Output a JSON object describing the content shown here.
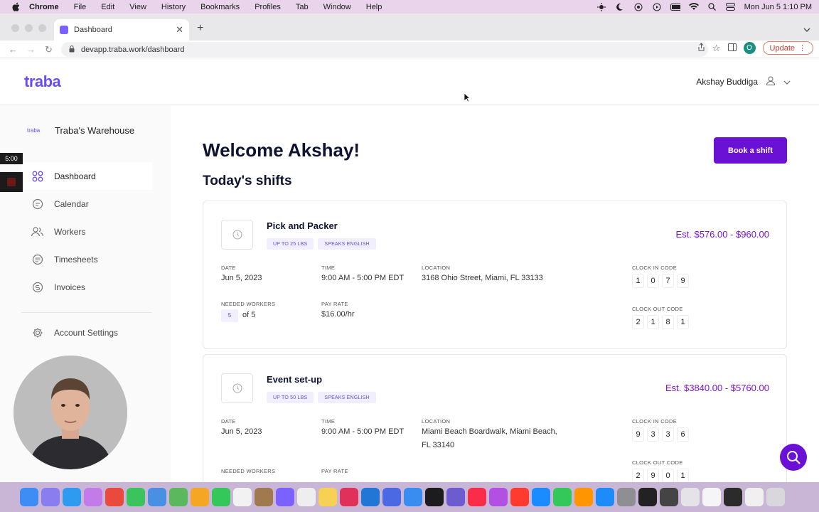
{
  "menubar": {
    "app": "Chrome",
    "items": [
      "File",
      "Edit",
      "View",
      "History",
      "Bookmarks",
      "Profiles",
      "Tab",
      "Window",
      "Help"
    ],
    "datetime": "Mon Jun 5  1:10 PM"
  },
  "browser": {
    "tab_title": "Dashboard",
    "url": "devapp.traba.work/dashboard",
    "profile_initial": "O",
    "update_label": "Update"
  },
  "header": {
    "logo": "traba",
    "user_name": "Akshay Buddiga"
  },
  "sidebar": {
    "org_logo": "traba",
    "org_name": "Traba's Warehouse",
    "items": [
      {
        "label": "Dashboard",
        "icon": "grid-icon"
      },
      {
        "label": "Calendar",
        "icon": "calendar-icon"
      },
      {
        "label": "Workers",
        "icon": "people-icon"
      },
      {
        "label": "Timesheets",
        "icon": "timesheet-icon"
      },
      {
        "label": "Invoices",
        "icon": "invoice-icon"
      }
    ],
    "settings_label": "Account Settings"
  },
  "recording": {
    "timer": "5:00"
  },
  "main": {
    "welcome": "Welcome Akshay!",
    "todays_shifts": "Today's shifts",
    "book_shift": "Book a shift",
    "labels": {
      "date": "DATE",
      "time": "TIME",
      "location": "LOCATION",
      "clock_in": "CLOCK IN CODE",
      "clock_out": "CLOCK OUT CODE",
      "needed_workers": "NEEDED WORKERS",
      "pay_rate": "PAY RATE"
    },
    "shifts": [
      {
        "title": "Pick and Packer",
        "tags": [
          "UP TO 25 LBS",
          "SPEAKS ENGLISH"
        ],
        "estimate": "Est. $576.00 - $960.00",
        "date": "Jun 5, 2023",
        "time": "9:00 AM - 5:00 PM EDT",
        "location": "3168 Ohio Street, Miami, FL 33133",
        "clock_in": [
          "1",
          "0",
          "7",
          "9"
        ],
        "clock_out": [
          "2",
          "1",
          "8",
          "1"
        ],
        "workers_filled": "5",
        "workers_total": "of 5",
        "pay_rate": "$16.00/hr"
      },
      {
        "title": "Event set-up",
        "tags": [
          "UP TO 50 LBS",
          "SPEAKS ENGLISH"
        ],
        "estimate": "Est. $3840.00 - $5760.00",
        "date": "Jun 5, 2023",
        "time": "9:00 AM - 5:00 PM EDT",
        "location_line1": "Miami Beach Boardwalk, Miami Beach,",
        "location_line2": "FL 33140",
        "clock_in": [
          "9",
          "3",
          "3",
          "6"
        ],
        "clock_out": [
          "2",
          "9",
          "0",
          "1"
        ]
      }
    ]
  },
  "colors": {
    "brand": "#6b11d6",
    "logo": "#6b4df0",
    "estimate": "#7a12d8"
  }
}
